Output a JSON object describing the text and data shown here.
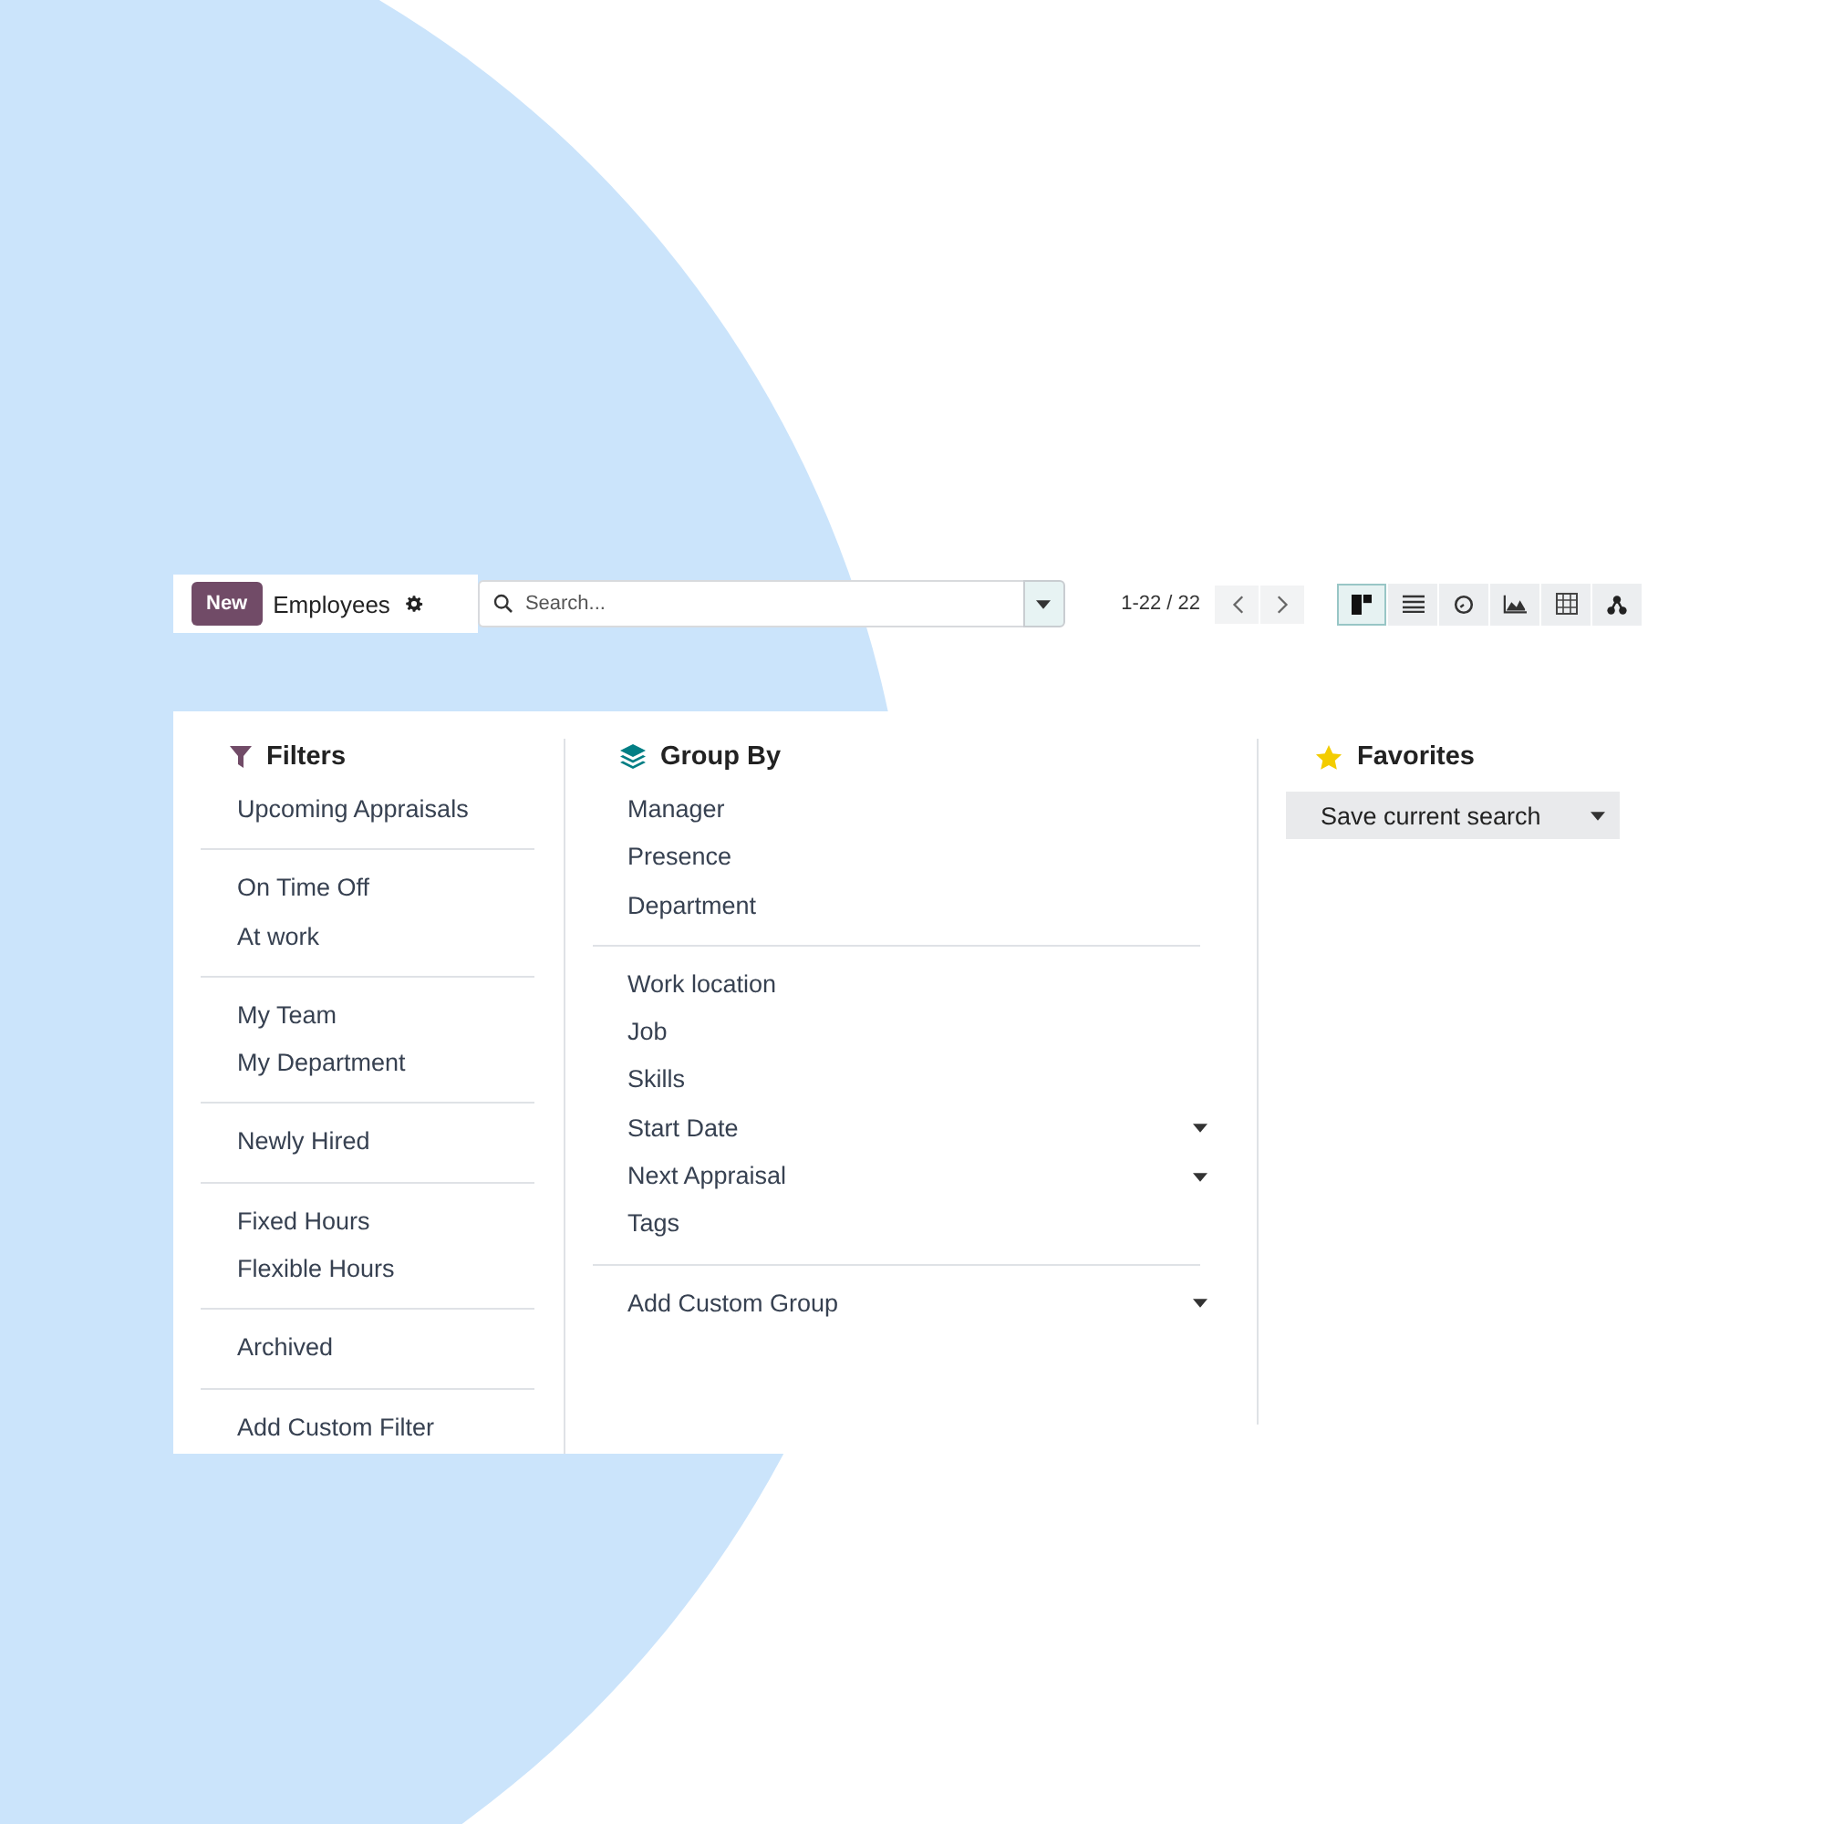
{
  "control_panel": {
    "new_button": "New",
    "title": "Employees",
    "search": {
      "placeholder": "Search..."
    },
    "pager": "1-22 / 22",
    "views": [
      {
        "kind": "kanban",
        "selected": true
      },
      {
        "kind": "list",
        "selected": false
      },
      {
        "kind": "activity",
        "selected": false
      },
      {
        "kind": "graph",
        "selected": false
      },
      {
        "kind": "pivot",
        "selected": false
      },
      {
        "kind": "hierarchy",
        "selected": false
      }
    ]
  },
  "filters": {
    "title": "Filters",
    "groups": [
      [
        "Upcoming Appraisals"
      ],
      [
        "On Time Off",
        "At work"
      ],
      [
        "My Team",
        "My Department"
      ],
      [
        "Newly Hired"
      ],
      [
        "Fixed Hours",
        "Flexible Hours"
      ],
      [
        "Archived"
      ],
      [
        "Add Custom Filter"
      ]
    ]
  },
  "group_by": {
    "title": "Group By",
    "groups": [
      [
        {
          "label": "Manager",
          "kind": "option"
        },
        {
          "label": "Presence",
          "kind": "option"
        },
        {
          "label": "Department",
          "kind": "option"
        }
      ],
      [
        {
          "label": "Work location",
          "kind": "option"
        },
        {
          "label": "Job",
          "kind": "option"
        },
        {
          "label": "Skills",
          "kind": "option"
        },
        {
          "label": "Start Date",
          "kind": "submenu"
        },
        {
          "label": "Next Appraisal",
          "kind": "submenu"
        },
        {
          "label": "Tags",
          "kind": "option"
        }
      ],
      [
        {
          "label": "Add Custom Group",
          "kind": "submenu"
        }
      ]
    ]
  },
  "favorites": {
    "title": "Favorites",
    "save_button": "Save current search"
  }
}
